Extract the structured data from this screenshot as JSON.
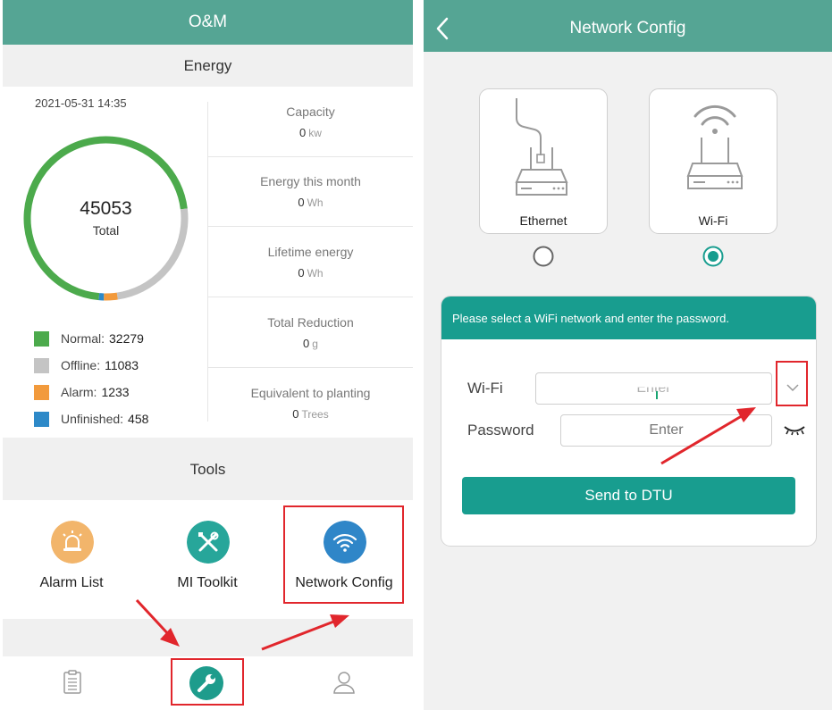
{
  "left_screen": {
    "header_title": "O&M",
    "energy_title": "Energy",
    "timestamp": "2021-05-31 14:35",
    "donut": {
      "total_value": "45053",
      "total_label": "Total",
      "segments": [
        {
          "name": "Normal",
          "value": 32279,
          "color": "#4caa4c"
        },
        {
          "name": "Offline",
          "value": 11083,
          "color": "#c4c4c4"
        },
        {
          "name": "Alarm",
          "value": 1233,
          "color": "#f29a3c"
        },
        {
          "name": "Unfinished",
          "value": 458,
          "color": "#2d89c8"
        }
      ]
    },
    "legend": [
      {
        "label": "Normal:",
        "value": "32279",
        "color": "#4caa4c"
      },
      {
        "label": "Offline:",
        "value": "11083",
        "color": "#c4c4c4"
      },
      {
        "label": "Alarm:",
        "value": "1233",
        "color": "#f29a3c"
      },
      {
        "label": "Unfinished:",
        "value": "458",
        "color": "#2d89c8"
      }
    ],
    "stats": [
      {
        "label": "Capacity",
        "value": "0",
        "unit": "kw"
      },
      {
        "label": "Energy this month",
        "value": "0",
        "unit": "Wh"
      },
      {
        "label": "Lifetime energy",
        "value": "0",
        "unit": "Wh"
      },
      {
        "label": "Total Reduction",
        "value": "0",
        "unit": "g"
      },
      {
        "label": "Equivalent to planting",
        "value": "0",
        "unit": "Trees"
      }
    ],
    "tools_title": "Tools",
    "tools": [
      {
        "label": "Alarm List",
        "icon": "alarm-siren-icon",
        "color": "#f2b56b"
      },
      {
        "label": "MI Toolkit",
        "icon": "tools-icon",
        "color": "#27a69a"
      },
      {
        "label": "Network Config",
        "icon": "wifi-icon",
        "color": "#2f86c8"
      }
    ],
    "tab_bar": [
      {
        "icon": "clipboard-icon"
      },
      {
        "icon": "wrench-icon",
        "active": true
      },
      {
        "icon": "user-icon"
      }
    ]
  },
  "right_screen": {
    "header_title": "Network Config",
    "modes": [
      {
        "label": "Ethernet",
        "icon": "ethernet-router-icon",
        "selected": false
      },
      {
        "label": "Wi-Fi",
        "icon": "wifi-router-icon",
        "selected": true
      }
    ],
    "form": {
      "instruction": "Please select a WiFi network and enter the password.",
      "wifi_label": "Wi-Fi",
      "wifi_value": "Enter",
      "password_label": "Password",
      "password_placeholder": "Enter",
      "send_button": "Send to DTU"
    }
  },
  "colors": {
    "header_green": "#55a594",
    "teal": "#189d8f",
    "annotation_red": "#e1262c"
  }
}
